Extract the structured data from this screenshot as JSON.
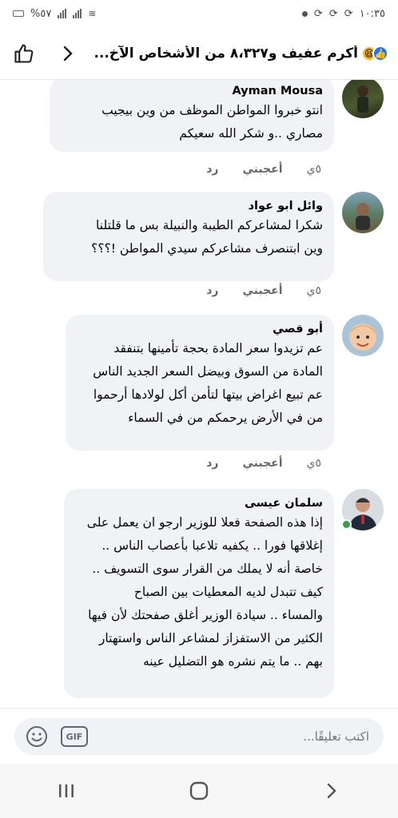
{
  "status_bar": {
    "battery": "%٥٧",
    "time": "١٠:٣٥"
  },
  "header": {
    "title": "أكرم عفيف و٨،٣٢٧ من الأشخاص الآخ..."
  },
  "comments": [
    {
      "author": "Ayman Mousa",
      "lines": [
        "انتو خبروا المواطن الموظف من وين بيجيب",
        "مصاري ..و شكر الله سعيكم"
      ],
      "time": "٥ي",
      "like": "أعجبني",
      "reply": "رد"
    },
    {
      "author": "وائل ابو عواد",
      "lines": [
        "شكرا لمشاعركم الطيبة والنبيلة بس ما قلتلنا",
        "وين ابتنصرف مشاعركم سيدي المواطن !؟؟؟"
      ],
      "time": "٥ي",
      "like": "أعجبني",
      "reply": "رد"
    },
    {
      "author": "أبو قصي",
      "lines": [
        "عم تزيدوا سعر المادة بحجة تأمينها بتنفقد",
        "المادة من السوق وبيضل السعر الجديد الناس",
        "عم تبيع اغراض بيتها لتأمن أكل لولادها أرحموا",
        "من في الأرض يرحمكم من في السماء"
      ],
      "time": "٥ي",
      "like": "أعجبني",
      "reply": "رد"
    },
    {
      "author": "سلمان عيسى",
      "lines": [
        "إذا هذه الصفحة فعلا للوزير ارجو ان يعمل على",
        "إغلاقها فورا .. يكفيه تلاعبا بأعصاب الناس ..",
        "خاصة أنه لا يملك من القرار سوى التسويف ..",
        "كيف تتبدل لديه المعطيات بين الصباح",
        "والمساء .. سيادة الوزير أغلق صفحتك لأن فيها",
        "الكثير من الاستفزاز لمشاعر الناس واستهتار",
        "بهم .. ما يتم نشره هو التضليل عينه"
      ]
    }
  ],
  "composer": {
    "placeholder": "اكتب تعليقًا...",
    "gif_label": "GIF"
  }
}
